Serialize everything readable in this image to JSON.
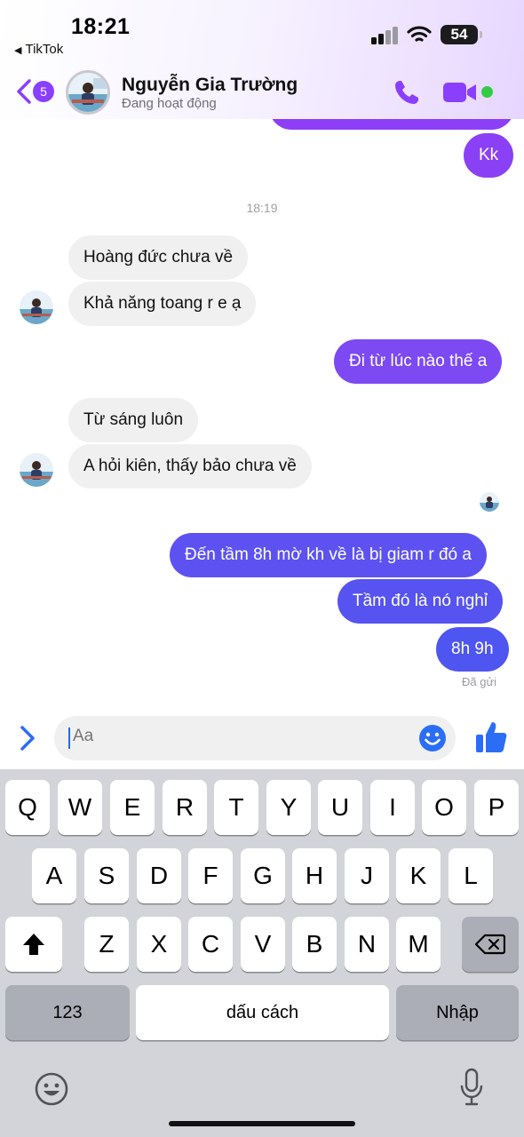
{
  "status_bar": {
    "time": "18:21",
    "back_app": "TikTok",
    "battery": "54"
  },
  "header": {
    "unread_count": "5",
    "contact_name": "Nguyễn Gia Trường",
    "contact_status": "Đang hoạt động",
    "call_icon": "phone-icon",
    "video_icon": "video-camera-icon"
  },
  "chat": {
    "timestamp": "18:19",
    "messages": [
      {
        "text": "Kk",
        "from": "me"
      },
      {
        "text": "Hoàng đức chưa về",
        "from": "them"
      },
      {
        "text": "Khả năng toang r e ạ",
        "from": "them"
      },
      {
        "text": "Đi từ lúc nào thế a",
        "from": "me"
      },
      {
        "text": "Từ sáng luôn",
        "from": "them"
      },
      {
        "text": "A hỏi kiên, thấy bảo chưa về",
        "from": "them"
      },
      {
        "text": "Đến tầm 8h mờ kh về là bị giam r đó a",
        "from": "me"
      },
      {
        "text": "Tầm đó là nó nghỉ",
        "from": "me"
      },
      {
        "text": "8h 9h",
        "from": "me"
      }
    ],
    "delivery_status": "Đã gửi"
  },
  "composer": {
    "placeholder": "Aa"
  },
  "keyboard": {
    "row1": [
      "Q",
      "W",
      "E",
      "R",
      "T",
      "Y",
      "U",
      "I",
      "O",
      "P"
    ],
    "row2": [
      "A",
      "S",
      "D",
      "F",
      "G",
      "H",
      "J",
      "K",
      "L"
    ],
    "row3": [
      "Z",
      "X",
      "C",
      "V",
      "B",
      "N",
      "M"
    ],
    "numbers_key": "123",
    "space_key": "dấu cách",
    "return_key": "Nhập"
  },
  "colors": {
    "accent": "#8a3ffc",
    "bubble_top": "#8b40f5",
    "bubble_bottom": "#4a55f0",
    "online": "#31cc46"
  }
}
